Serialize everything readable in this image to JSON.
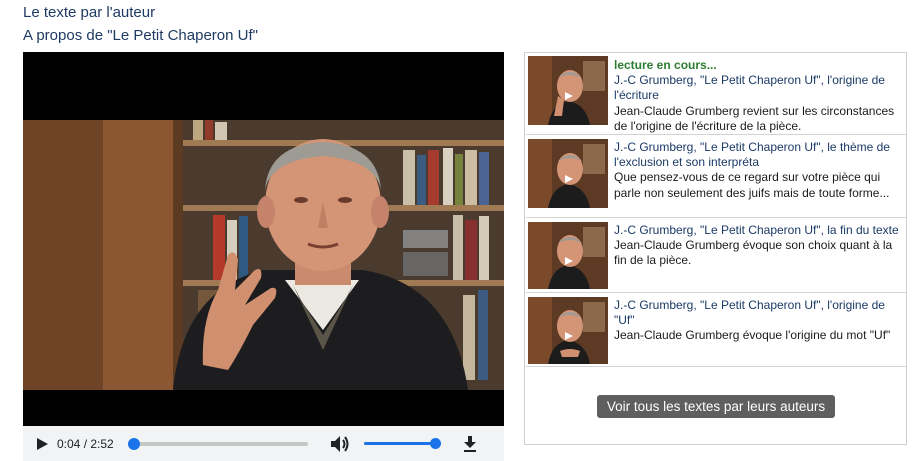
{
  "headings": {
    "line1": "Le texte par l'auteur",
    "line2": "A propos de \"Le Petit Chaperon Uf\""
  },
  "player": {
    "time": "0:04 / 2:52",
    "progress": 0.02,
    "volume": 1.0
  },
  "playlist": {
    "items": [
      {
        "status": "lecture en cours...",
        "title": "J.-C Grumberg, \"Le Petit Chaperon Uf\", l'origine de l'écriture",
        "description": "Jean-Claude Grumberg revient sur les circonstances de l'origine de l'écriture de la pièce."
      },
      {
        "status": "",
        "title": "J.-C Grumberg, \"Le Petit Chaperon Uf\", le thème de l'exclusion et son interpréta",
        "description": "Que pensez-vous de ce regard sur votre pièce qui parle non seulement des juifs mais de toute forme..."
      },
      {
        "status": "",
        "title": "J.-C Grumberg, \"Le Petit Chaperon Uf\", la fin du texte",
        "description": "Jean-Claude Grumberg évoque son choix quant à la fin de la pièce."
      },
      {
        "status": "",
        "title": "J.-C Grumberg, \"Le Petit Chaperon Uf\", l'origine de \"Uf\"",
        "description": "Jean-Claude Grumberg évoque l'origine du mot \"Uf\""
      }
    ],
    "all_button": "Voir tous les textes par leurs auteurs"
  },
  "colors": {
    "link": "#1b3a66",
    "playing": "#2e7d32",
    "accent": "#1a73e8",
    "button_bg": "#5f5f5f"
  }
}
